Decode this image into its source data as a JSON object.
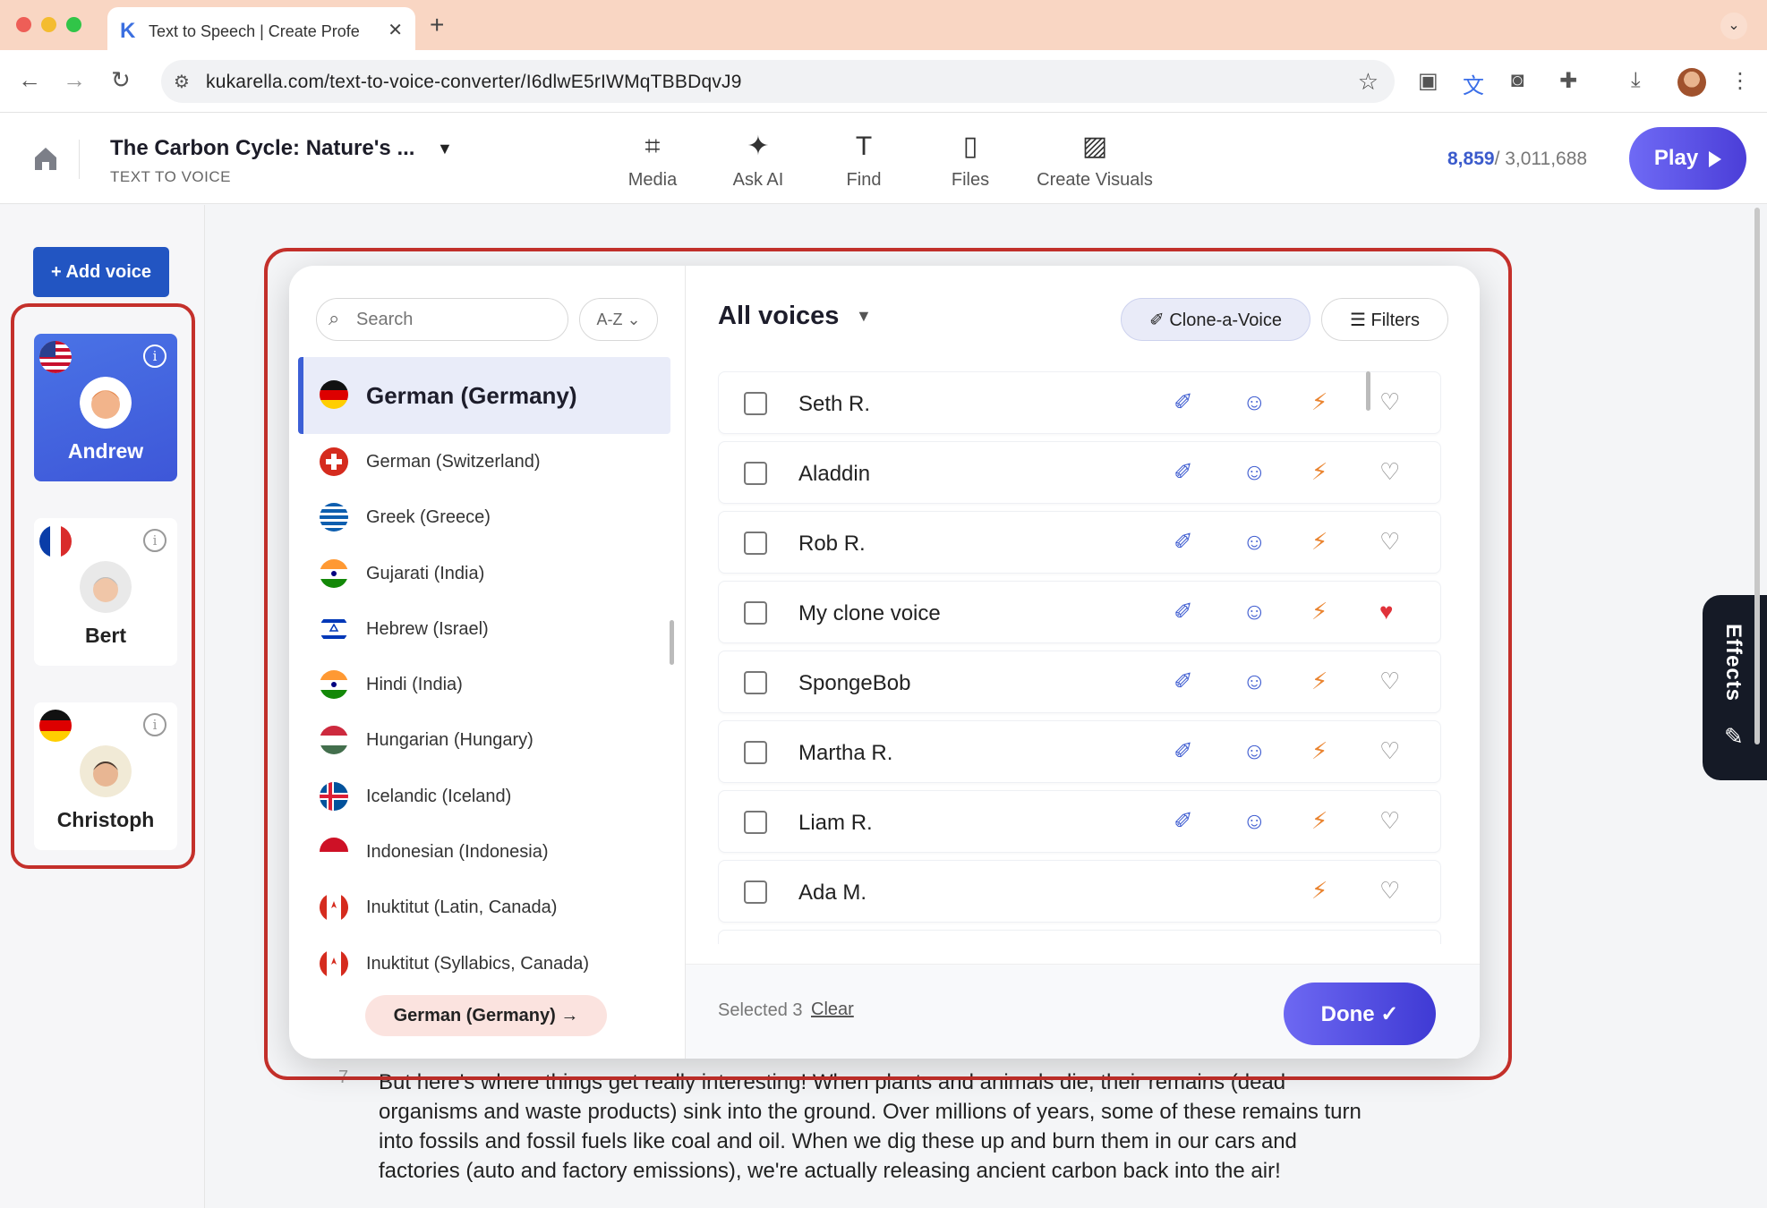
{
  "browser": {
    "tab_title": "Text to Speech | Create Profe",
    "tab_logo": "K",
    "url": "kukarella.com/text-to-voice-converter/I6dlwE5rIWMqTBBDqvJ9"
  },
  "header": {
    "doc_title": "The Carbon Cycle: Nature's ...",
    "doc_subtitle": "TEXT TO VOICE",
    "tools": [
      {
        "label": "Media",
        "icon": "media-icon"
      },
      {
        "label": "Ask AI",
        "icon": "sparkles-icon"
      },
      {
        "label": "Find",
        "icon": "find-icon"
      },
      {
        "label": "Files",
        "icon": "files-icon"
      },
      {
        "label": "Create Visuals",
        "icon": "visuals-icon"
      }
    ],
    "counter_used": "8,859",
    "counter_total": "/ 3,011,688",
    "play_label": "Play"
  },
  "sidebar": {
    "add_voice_label": "+ Add voice",
    "speakers": [
      {
        "name": "Andrew",
        "flag": "us",
        "active": true
      },
      {
        "name": "Bert",
        "flag": "fr",
        "active": false
      },
      {
        "name": "Christoph",
        "flag": "de",
        "active": false
      }
    ]
  },
  "modal": {
    "search_placeholder": "Search",
    "sort_label": "A-Z",
    "selected_language": "German (Germany)",
    "languages": [
      "German (Switzerland)",
      "Greek (Greece)",
      "Gujarati (India)",
      "Hebrew (Israel)",
      "Hindi (India)",
      "Hungarian (Hungary)",
      "Icelandic (Iceland)",
      "Indonesian (Indonesia)",
      "Inuktitut (Latin, Canada)",
      "Inuktitut (Syllabics, Canada)"
    ],
    "language_pill": "German (Germany) →",
    "voices_title": "All voices",
    "clone_label": "Clone-a-Voice",
    "filters_label": "Filters",
    "voices": [
      {
        "name": "Seth R.",
        "clone": true,
        "mask": true,
        "fav": false
      },
      {
        "name": "Aladdin",
        "clone": true,
        "mask": true,
        "fav": false
      },
      {
        "name": "Rob R.",
        "clone": true,
        "mask": true,
        "fav": false
      },
      {
        "name": "My clone voice",
        "clone": true,
        "mask": true,
        "fav": true
      },
      {
        "name": "SpongeBob",
        "clone": true,
        "mask": true,
        "fav": false
      },
      {
        "name": "Martha R.",
        "clone": true,
        "mask": true,
        "fav": false
      },
      {
        "name": "Liam R.",
        "clone": true,
        "mask": true,
        "fav": false
      },
      {
        "name": "Ada M.",
        "clone": false,
        "mask": false,
        "fav": false
      }
    ],
    "selected_text": "Selected 3",
    "clear_label": "Clear",
    "done_label": "Done ✓"
  },
  "editor": {
    "line_number": "7",
    "paragraph": "But here's where things get really interesting! When plants and animals die, their remains (dead organisms and waste products) sink into the ground. Over millions of years, some of these remains turn into fossils and fossil fuels like coal and oil. When we dig these up and burn them in our cars and factories (auto and factory emissions), we're actually releasing ancient carbon back into the air!"
  },
  "effects": {
    "label": "Effects"
  }
}
